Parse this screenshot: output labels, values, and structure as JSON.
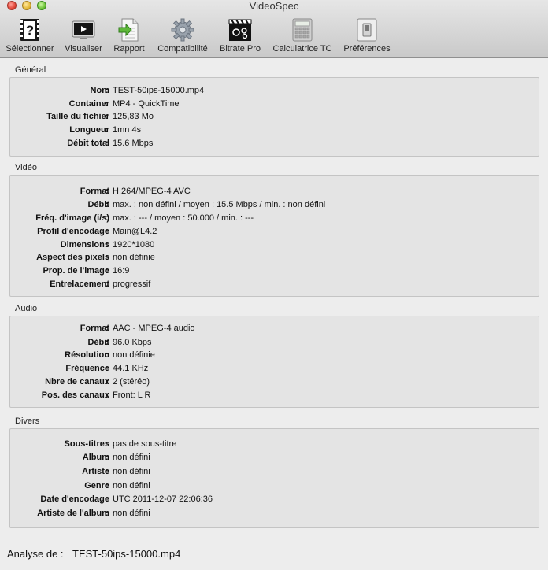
{
  "window": {
    "title": "VideoSpec"
  },
  "toolbar": {
    "items": [
      {
        "label": "Sélectionner",
        "icon": "clapperboard-question-icon"
      },
      {
        "label": "Visualiser",
        "icon": "monitor-play-icon"
      },
      {
        "label": "Rapport",
        "icon": "document-export-icon"
      },
      {
        "label": "Compatibilité",
        "icon": "gear-icon"
      },
      {
        "label": "Bitrate Pro",
        "icon": "clapperboard-gears-icon"
      },
      {
        "label": "Calculatrice TC",
        "icon": "calculator-icon"
      },
      {
        "label": "Préférences",
        "icon": "switch-icon"
      }
    ]
  },
  "sections": {
    "general": {
      "title": "Général",
      "rows": [
        {
          "label": "Nom",
          "value": "TEST-50ips-15000.mp4"
        },
        {
          "label": "Container",
          "value": "MP4 - QuickTime"
        },
        {
          "label": "Taille du fichier",
          "value": "125,83 Mo"
        },
        {
          "label": "Longueur",
          "value": "1mn 4s"
        },
        {
          "label": "Débit total",
          "value": "15.6 Mbps"
        }
      ]
    },
    "video": {
      "title": "Vidéo",
      "rows": [
        {
          "label": "Format",
          "value": "H.264/MPEG-4 AVC"
        },
        {
          "label": "Débit",
          "value": "max. : non défini / moyen : 15.5 Mbps / min. : non défini"
        },
        {
          "label": "Fréq. d'image (i/s)",
          "value": "max. : --- / moyen : 50.000 / min. : ---"
        },
        {
          "label": "Profil d'encodage",
          "value": "Main@L4.2"
        },
        {
          "label": "Dimensions",
          "value": "1920*1080"
        },
        {
          "label": "Aspect des pixels",
          "value": "non définie"
        },
        {
          "label": "Prop. de l'image",
          "value": "16:9"
        },
        {
          "label": "Entrelacement",
          "value": "progressif"
        }
      ]
    },
    "audio": {
      "title": "Audio",
      "rows": [
        {
          "label": "Format",
          "value": "AAC - MPEG-4 audio"
        },
        {
          "label": "Débit",
          "value": "96.0 Kbps"
        },
        {
          "label": "Résolution",
          "value": "non définie"
        },
        {
          "label": "Fréquence",
          "value": "44.1 KHz"
        },
        {
          "label": "Nbre de canaux",
          "value": "2 (stéréo)"
        },
        {
          "label": "Pos. des  canaux",
          "value": "Front: L R"
        }
      ]
    },
    "divers": {
      "title": "Divers",
      "rows": [
        {
          "label": "Sous-titres",
          "value": "pas de sous-titre"
        },
        {
          "label": "Album",
          "value": "non défini"
        },
        {
          "label": "Artiste",
          "value": "non défini"
        },
        {
          "label": "Genre",
          "value": "non défini"
        },
        {
          "label": "Date d'encodage",
          "value": "UTC 2011-12-07 22:06:36"
        },
        {
          "label": "Artiste de l'album",
          "value": "non défini"
        }
      ]
    }
  },
  "footer": {
    "label": "Analyse de :",
    "file": "TEST-50ips-15000.mp4"
  }
}
